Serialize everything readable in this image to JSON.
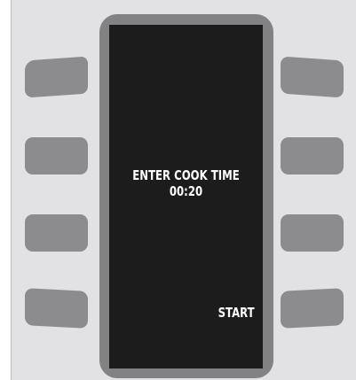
{
  "display": {
    "prompt": "ENTER COOK TIME",
    "time_value": "00:20",
    "soft_label_right_4": "START"
  },
  "keys": {
    "left": [
      "",
      "",
      "",
      ""
    ],
    "right": [
      "",
      "",
      "",
      ""
    ]
  },
  "colors": {
    "panel": "#e2e2e4",
    "bezel": "#828284",
    "screen": "#1c1c1c",
    "key": "#8c8c8e",
    "text": "#ffffff"
  }
}
